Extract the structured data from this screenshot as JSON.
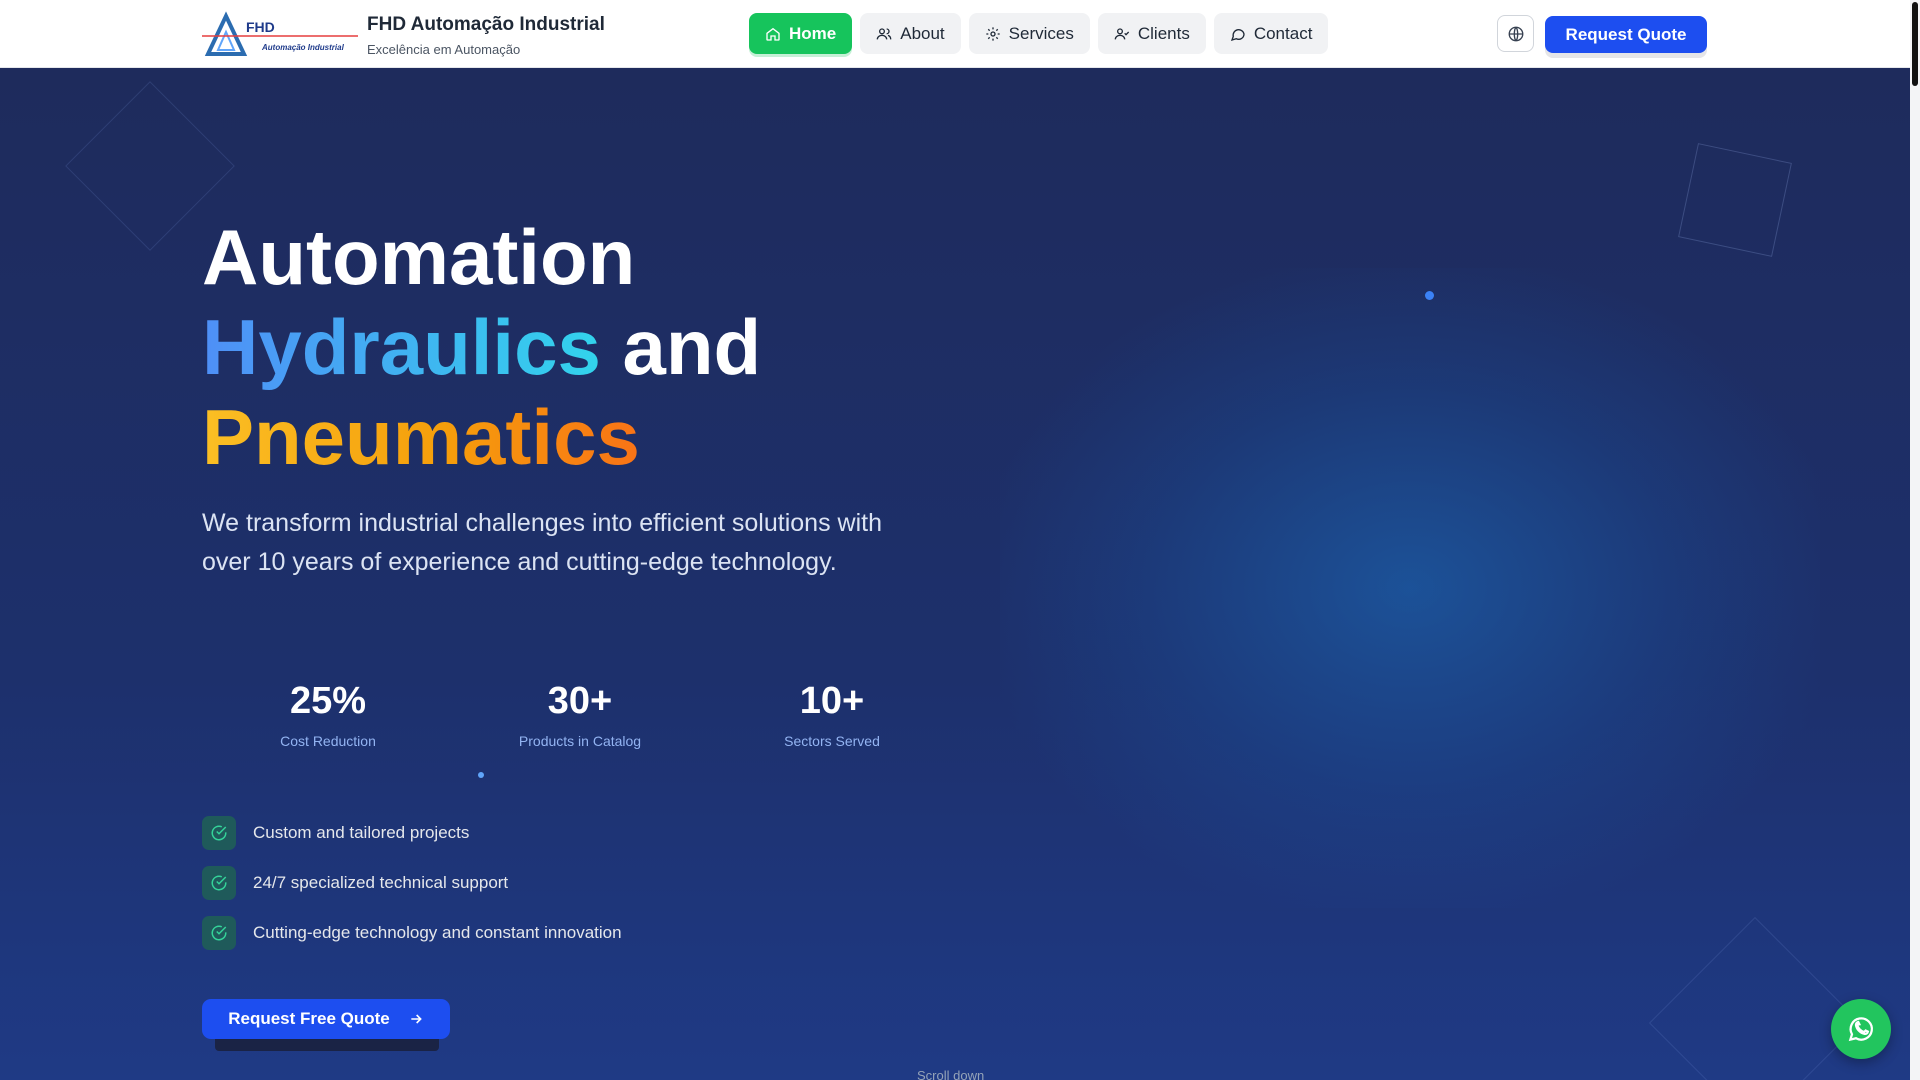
{
  "brand": {
    "logo_text": "FHD",
    "logo_subtext": "Automação Industrial",
    "title": "FHD Automação Industrial",
    "subtitle": "Excelência em Automação"
  },
  "nav": {
    "items": [
      {
        "label": "Home",
        "icon": "home-icon",
        "active": true
      },
      {
        "label": "About",
        "icon": "users-icon",
        "active": false
      },
      {
        "label": "Services",
        "icon": "gear-icon",
        "active": false
      },
      {
        "label": "Clients",
        "icon": "user-check-icon",
        "active": false
      },
      {
        "label": "Contact",
        "icon": "chat-icon",
        "active": false
      }
    ],
    "language_icon": "globe-icon",
    "quote_label": "Request Quote"
  },
  "hero": {
    "line1": "Automation",
    "line2_highlight": "Hydraulics",
    "line2_rest": "and",
    "line3_highlight": "Pneumatics",
    "lead": "We transform industrial challenges into efficient solutions with over 10 years of experience and cutting-edge technology.",
    "stats": [
      {
        "value": "25%",
        "label": "Cost Reduction"
      },
      {
        "value": "30+",
        "label": "Products in Catalog"
      },
      {
        "value": "10+",
        "label": "Sectors Served"
      }
    ],
    "features": [
      "Custom and tailored projects",
      "24/7 specialized technical support",
      "Cutting-edge technology and constant innovation"
    ],
    "cta_label": "Request Free Quote",
    "scroll_hint": "Scroll down"
  },
  "colors": {
    "active_nav": "#16c45c",
    "primary": "#1d4ef0",
    "hero_bg": "#1e2b5c",
    "whatsapp": "#22c55e"
  },
  "whatsapp_icon": "whatsapp-icon"
}
